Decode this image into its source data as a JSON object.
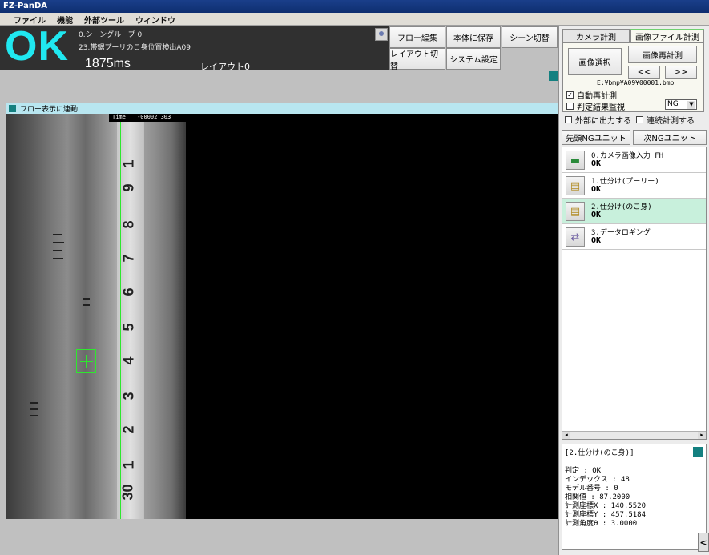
{
  "window": {
    "title": "FZ-PanDA"
  },
  "menu": [
    "ファイル",
    "機能",
    "外部ツール",
    "ウィンドウ"
  ],
  "status": {
    "result": "OK",
    "scene_group": "0.シーングループ 0",
    "scene_name": "23.帯鋸プーリのこ身位置検出A09",
    "time": "1875ms",
    "layout": "レイアウト0"
  },
  "toolbar": {
    "flow_edit": "フロー編集",
    "save": "本体に保存",
    "scene_switch": "シーン切替",
    "layout_switch": "レイアウト切替",
    "system_settings": "システム設定"
  },
  "tabs": {
    "camera": "カメラ計測",
    "file": "画像ファイル計測"
  },
  "file_panel": {
    "select_image": "画像選択",
    "remeasure": "画像再計測",
    "prev": "<<",
    "next": ">>",
    "path": "E:¥bmp¥A09¥00001.bmp",
    "auto_remeasure": "自動再計測",
    "monitor": "判定結果監視",
    "filter_value": "NG"
  },
  "options": {
    "output_external": "外部に出力する",
    "continuous": "連続計測する"
  },
  "nav": {
    "first_ng": "先頭NGユニット",
    "next_ng": "次NGユニット"
  },
  "units": [
    {
      "name": "0.カメラ画像入力 FH",
      "result": "OK",
      "icon": "camera-icon"
    },
    {
      "name": "1.仕分け(プーリー)",
      "result": "OK",
      "icon": "folder-icon"
    },
    {
      "name": "2.仕分け(のこ身)",
      "result": "OK",
      "icon": "folder-icon"
    },
    {
      "name": "3.データロギング",
      "result": "OK",
      "icon": "logging-icon"
    }
  ],
  "detail": {
    "title": "[2.仕分け(のこ身)]",
    "lines": [
      "判定 : OK",
      "インデックス : 48",
      "モデル番号 : 0",
      "相関値 : 87.2000",
      "計測座標X : 140.5520",
      "計測座標Y : 457.5184",
      "計測角度θ : 3.0000"
    ]
  },
  "image": {
    "flow_link": "フロー表示に連動",
    "time_label": "Time",
    "time_value": "-00002.303",
    "ruler_numbers": [
      "1",
      "9",
      "8",
      "7",
      "6",
      "5",
      "4",
      "3",
      "2",
      "1",
      "30"
    ]
  },
  "collapse": "<",
  "colors": {
    "ok": "#20e8f0",
    "overlay": "#2ee82e",
    "accent": "#148080"
  }
}
